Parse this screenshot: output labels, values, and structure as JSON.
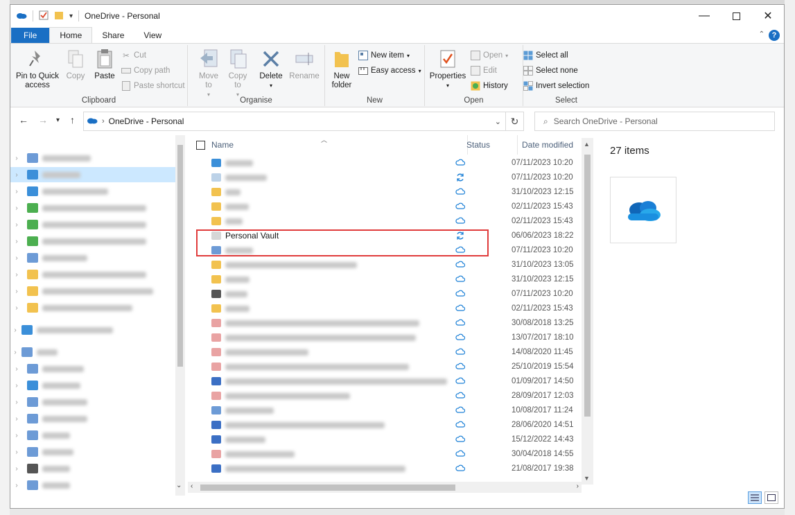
{
  "window": {
    "title": "OneDrive - Personal"
  },
  "tabs": [
    {
      "label": "File"
    },
    {
      "label": "Home"
    },
    {
      "label": "Share"
    },
    {
      "label": "View"
    }
  ],
  "ribbon": {
    "clipboard": {
      "label": "Clipboard",
      "pin": "Pin to Quick access",
      "copy": "Copy",
      "paste": "Paste",
      "cut": "Cut",
      "copy_path": "Copy path",
      "paste_shortcut": "Paste shortcut"
    },
    "organise": {
      "label": "Organise",
      "move_to": "Move to",
      "copy_to": "Copy to",
      "delete": "Delete",
      "rename": "Rename"
    },
    "new": {
      "label": "New",
      "new_folder": "New folder",
      "new_item": "New item",
      "easy_access": "Easy access"
    },
    "open": {
      "label": "Open",
      "properties": "Properties",
      "open": "Open",
      "edit": "Edit",
      "history": "History"
    },
    "select": {
      "label": "Select",
      "select_all": "Select all",
      "select_none": "Select none",
      "invert": "Invert selection"
    }
  },
  "address": {
    "path": "OneDrive - Personal",
    "search_placeholder": "Search OneDrive - Personal"
  },
  "columns": {
    "name": "Name",
    "status": "Status",
    "date": "Date modified"
  },
  "files": [
    {
      "name": "",
      "status": "cloud",
      "date": "07/11/2023 10:20",
      "icon_color": "#3b8fd9"
    },
    {
      "name": "",
      "status": "sync",
      "date": "07/11/2023 10:20",
      "icon_color": "#bcd2e8"
    },
    {
      "name": "",
      "status": "cloud",
      "date": "31/10/2023 12:15",
      "icon_color": "#f2c24f"
    },
    {
      "name": "",
      "status": "cloud",
      "date": "02/11/2023 15:43",
      "icon_color": "#f2c24f"
    },
    {
      "name": "",
      "status": "cloud",
      "date": "02/11/2023 15:43",
      "icon_color": "#f2c24f"
    },
    {
      "name": "Personal Vault",
      "status": "sync",
      "date": "06/06/2023 18:22",
      "icon_color": "#d6d6d6"
    },
    {
      "name": "",
      "status": "cloud",
      "date": "07/11/2023 10:20",
      "icon_color": "#6d9bd6"
    },
    {
      "name": "",
      "status": "cloud",
      "date": "31/10/2023 13:05",
      "icon_color": "#f2c24f"
    },
    {
      "name": "",
      "status": "cloud",
      "date": "31/10/2023 12:15",
      "icon_color": "#f2c24f"
    },
    {
      "name": "",
      "status": "cloud",
      "date": "07/11/2023 10:20",
      "icon_color": "#555"
    },
    {
      "name": "",
      "status": "cloud",
      "date": "02/11/2023 15:43",
      "icon_color": "#f2c24f"
    },
    {
      "name": "",
      "status": "cloud",
      "date": "30/08/2018 13:25",
      "icon_color": "#e9a3a3"
    },
    {
      "name": "",
      "status": "cloud",
      "date": "13/07/2017 18:10",
      "icon_color": "#e9a3a3"
    },
    {
      "name": "",
      "status": "cloud",
      "date": "14/08/2020 11:45",
      "icon_color": "#e9a3a3"
    },
    {
      "name": "",
      "status": "cloud",
      "date": "25/10/2019 15:54",
      "icon_color": "#e9a3a3"
    },
    {
      "name": "",
      "status": "cloud",
      "date": "01/09/2017 14:50",
      "icon_color": "#3b6fc4"
    },
    {
      "name": "",
      "status": "cloud",
      "date": "28/09/2017 12:03",
      "icon_color": "#e9a3a3"
    },
    {
      "name": "",
      "status": "cloud",
      "date": "10/08/2017 11:24",
      "icon_color": "#6d9bd6"
    },
    {
      "name": "",
      "status": "cloud",
      "date": "28/06/2020 14:51",
      "icon_color": "#3b6fc4"
    },
    {
      "name": "",
      "status": "cloud",
      "date": "15/12/2022 14:43",
      "icon_color": "#3b6fc4"
    },
    {
      "name": "",
      "status": "cloud",
      "date": "30/04/2018 14:55",
      "icon_color": "#e9a3a3"
    },
    {
      "name": "",
      "status": "cloud",
      "date": "21/08/2017 19:38",
      "icon_color": "#3b6fc4"
    }
  ],
  "details": {
    "count": "27 items"
  },
  "nav_items": [
    {
      "icon_color": "#6d9bd6",
      "width": 70
    },
    {
      "icon_color": "#3b8fd9",
      "width": 55,
      "selected": true
    },
    {
      "icon_color": "#3b8fd9",
      "width": 95
    },
    {
      "icon_color": "#4caf50",
      "width": 150
    },
    {
      "icon_color": "#4caf50",
      "width": 150
    },
    {
      "icon_color": "#4caf50",
      "width": 150
    },
    {
      "icon_color": "#6d9bd6",
      "width": 65
    },
    {
      "icon_color": "#f2c24f",
      "width": 150
    },
    {
      "icon_color": "#f2c24f",
      "width": 160
    },
    {
      "icon_color": "#f2c24f",
      "width": 130
    },
    {
      "icon_color": "#3b8fd9",
      "width": 110
    },
    {
      "icon_color": "#6d9bd6",
      "width": 30
    },
    {
      "icon_color": "#6d9bd6",
      "width": 60
    },
    {
      "icon_color": "#3b8fd9",
      "width": 55
    },
    {
      "icon_color": "#6d9bd6",
      "width": 65
    },
    {
      "icon_color": "#6d9bd6",
      "width": 65
    },
    {
      "icon_color": "#6d9bd6",
      "width": 40
    },
    {
      "icon_color": "#6d9bd6",
      "width": 45
    },
    {
      "icon_color": "#555555",
      "width": 40
    },
    {
      "icon_color": "#6d9bd6",
      "width": 40
    }
  ]
}
